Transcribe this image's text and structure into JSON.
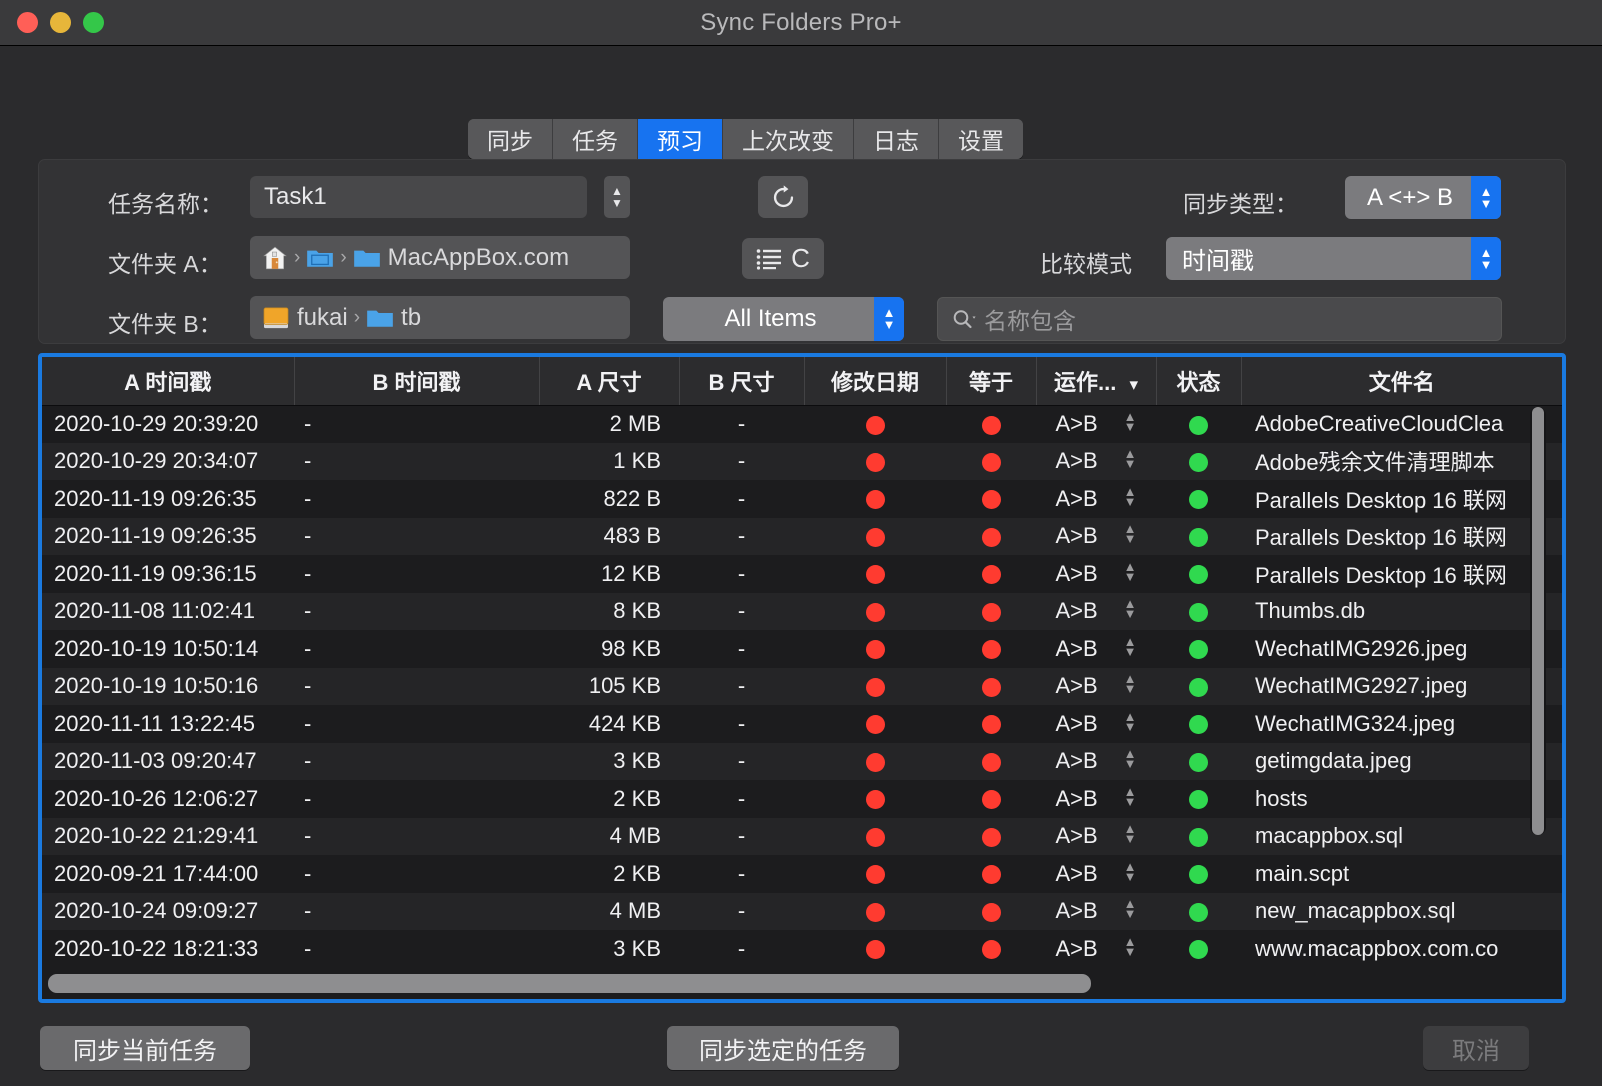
{
  "window": {
    "title": "Sync Folders Pro+",
    "traffic_lights": [
      "close-red",
      "minimize-yellow",
      "zoom-green"
    ]
  },
  "tabs": [
    {
      "label": "同步",
      "active": false
    },
    {
      "label": "任务",
      "active": false
    },
    {
      "label": "预习",
      "active": true
    },
    {
      "label": "上次改变",
      "active": false
    },
    {
      "label": "日志",
      "active": false
    },
    {
      "label": "设置",
      "active": false
    }
  ],
  "form": {
    "task_name_label": "任务名称：",
    "task_name_value": "Task1",
    "folder_a_label": "文件夹 A：",
    "folder_a_path": [
      "MacAppBox.com"
    ],
    "folder_b_label": "文件夹 B：",
    "folder_b_path": [
      "fukai",
      "tb"
    ],
    "refresh_icon": "refresh-icon",
    "compare_button_label": "C",
    "filter_value": "All Items",
    "sync_type_label": "同步类型：",
    "sync_type_value": "A <+> B",
    "compare_mode_label": "比较模式",
    "compare_mode_value": "时间戳",
    "search_placeholder": "名称包含",
    "search_value": ""
  },
  "table": {
    "columns": [
      {
        "key": "a_time",
        "label": "A 时间戳"
      },
      {
        "key": "b_time",
        "label": "B 时间戳"
      },
      {
        "key": "a_size",
        "label": "A 尺寸"
      },
      {
        "key": "b_size",
        "label": "B 尺寸"
      },
      {
        "key": "modified",
        "label": "修改日期"
      },
      {
        "key": "equal",
        "label": "等于"
      },
      {
        "key": "action",
        "label": "运作..."
      },
      {
        "key": "status",
        "label": "状态"
      },
      {
        "key": "filename",
        "label": "文件名"
      }
    ],
    "action_header_menu_icon": "chevron-down-icon",
    "rows": [
      {
        "a_time": "2020-10-29 20:39:20",
        "b_time": "-",
        "a_size": "2 MB",
        "b_size": "-",
        "modified": "red",
        "equal": "red",
        "action": "A>B",
        "status": "green",
        "filename": "AdobeCreativeCloudClea"
      },
      {
        "a_time": "2020-10-29 20:34:07",
        "b_time": "-",
        "a_size": "1 KB",
        "b_size": "-",
        "modified": "red",
        "equal": "red",
        "action": "A>B",
        "status": "green",
        "filename": "Adobe残余文件清理脚本"
      },
      {
        "a_time": "2020-11-19 09:26:35",
        "b_time": "-",
        "a_size": "822 B",
        "b_size": "-",
        "modified": "red",
        "equal": "red",
        "action": "A>B",
        "status": "green",
        "filename": "Parallels Desktop 16 联网"
      },
      {
        "a_time": "2020-11-19 09:26:35",
        "b_time": "-",
        "a_size": "483 B",
        "b_size": "-",
        "modified": "red",
        "equal": "red",
        "action": "A>B",
        "status": "green",
        "filename": "Parallels Desktop 16 联网"
      },
      {
        "a_time": "2020-11-19 09:36:15",
        "b_time": "-",
        "a_size": "12 KB",
        "b_size": "-",
        "modified": "red",
        "equal": "red",
        "action": "A>B",
        "status": "green",
        "filename": "Parallels Desktop 16 联网"
      },
      {
        "a_time": "2020-11-08 11:02:41",
        "b_time": "-",
        "a_size": "8 KB",
        "b_size": "-",
        "modified": "red",
        "equal": "red",
        "action": "A>B",
        "status": "green",
        "filename": "Thumbs.db"
      },
      {
        "a_time": "2020-10-19 10:50:14",
        "b_time": "-",
        "a_size": "98 KB",
        "b_size": "-",
        "modified": "red",
        "equal": "red",
        "action": "A>B",
        "status": "green",
        "filename": "WechatIMG2926.jpeg"
      },
      {
        "a_time": "2020-10-19 10:50:16",
        "b_time": "-",
        "a_size": "105 KB",
        "b_size": "-",
        "modified": "red",
        "equal": "red",
        "action": "A>B",
        "status": "green",
        "filename": "WechatIMG2927.jpeg"
      },
      {
        "a_time": "2020-11-11 13:22:45",
        "b_time": "-",
        "a_size": "424 KB",
        "b_size": "-",
        "modified": "red",
        "equal": "red",
        "action": "A>B",
        "status": "green",
        "filename": "WechatIMG324.jpeg"
      },
      {
        "a_time": "2020-11-03 09:20:47",
        "b_time": "-",
        "a_size": "3 KB",
        "b_size": "-",
        "modified": "red",
        "equal": "red",
        "action": "A>B",
        "status": "green",
        "filename": "getimgdata.jpeg"
      },
      {
        "a_time": "2020-10-26 12:06:27",
        "b_time": "-",
        "a_size": "2 KB",
        "b_size": "-",
        "modified": "red",
        "equal": "red",
        "action": "A>B",
        "status": "green",
        "filename": "hosts"
      },
      {
        "a_time": "2020-10-22 21:29:41",
        "b_time": "-",
        "a_size": "4 MB",
        "b_size": "-",
        "modified": "red",
        "equal": "red",
        "action": "A>B",
        "status": "green",
        "filename": "macappbox.sql"
      },
      {
        "a_time": "2020-09-21 17:44:00",
        "b_time": "-",
        "a_size": "2 KB",
        "b_size": "-",
        "modified": "red",
        "equal": "red",
        "action": "A>B",
        "status": "green",
        "filename": "main.scpt"
      },
      {
        "a_time": "2020-10-24 09:09:27",
        "b_time": "-",
        "a_size": "4 MB",
        "b_size": "-",
        "modified": "red",
        "equal": "red",
        "action": "A>B",
        "status": "green",
        "filename": "new_macappbox.sql"
      },
      {
        "a_time": "2020-10-22 18:21:33",
        "b_time": "-",
        "a_size": "3 KB",
        "b_size": "-",
        "modified": "red",
        "equal": "red",
        "action": "A>B",
        "status": "green",
        "filename": "www.macappbox.com.co"
      }
    ]
  },
  "footer": {
    "sync_current_label": "同步当前任务",
    "sync_selected_label": "同步选定的任务",
    "cancel_label": "取消"
  },
  "colors": {
    "accent_blue": "#1773f0",
    "selection_border": "#1a7ae0",
    "status_green": "#30d94f",
    "status_red": "#ff3b30",
    "window_bg": "#2b2b2d",
    "table_bg": "#1c1c1e"
  }
}
